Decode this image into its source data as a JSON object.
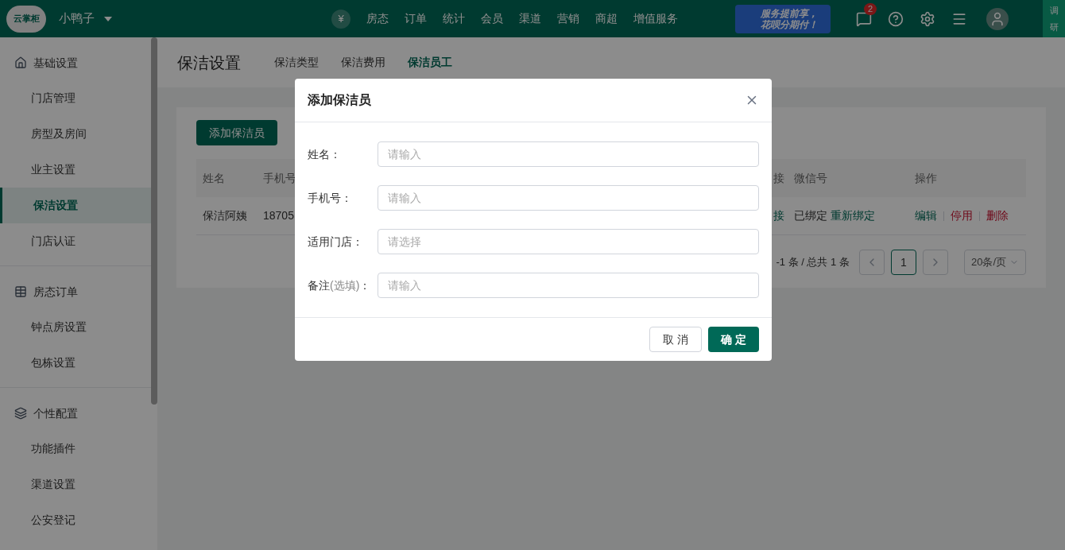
{
  "header": {
    "logo": "云掌柜",
    "store": "小鸭子",
    "currency_icon": "¥",
    "nav": [
      {
        "label": "房态"
      },
      {
        "label": "订单"
      },
      {
        "label": "统计"
      },
      {
        "label": "会员"
      },
      {
        "label": "渠道"
      },
      {
        "label": "营销"
      },
      {
        "label": "商超"
      },
      {
        "label": "增值服务"
      }
    ],
    "banner": {
      "line1": "服务提前享，",
      "line2": "花呗分期付！"
    },
    "message_count": "2",
    "survey": "调研"
  },
  "sidebar": [
    {
      "title": "基础设置",
      "items": [
        {
          "label": "门店管理",
          "selected": false
        },
        {
          "label": "房型及房间",
          "selected": false
        },
        {
          "label": "业主设置",
          "selected": false
        },
        {
          "label": "保洁设置",
          "selected": true
        },
        {
          "label": "门店认证",
          "selected": false
        }
      ]
    },
    {
      "title": "房态订单",
      "items": [
        {
          "label": "钟点房设置",
          "selected": false
        },
        {
          "label": "包栋设置",
          "selected": false
        }
      ]
    },
    {
      "title": "个性配置",
      "items": [
        {
          "label": "功能插件",
          "selected": false
        },
        {
          "label": "渠道设置",
          "selected": false
        },
        {
          "label": "公安登记",
          "selected": false
        }
      ]
    }
  ],
  "page": {
    "title": "保洁设置",
    "tabs": [
      {
        "label": "保洁类型",
        "selected": false
      },
      {
        "label": "保洁费用",
        "selected": false
      },
      {
        "label": "保洁员工",
        "selected": true
      }
    ],
    "add_button": "添加保洁员",
    "table": {
      "columns": [
        "姓名",
        "手机号",
        "接",
        "微信号",
        "操作"
      ],
      "rows": [
        {
          "name": "保洁阿姨",
          "phone": "18705",
          "column_3": "接",
          "wechat": "已绑定",
          "rebind": "重新绑定",
          "actions": [
            {
              "label": "编辑",
              "kind": "normal"
            },
            {
              "label": "停用",
              "kind": "danger"
            },
            {
              "label": "删除",
              "kind": "danger"
            }
          ]
        }
      ]
    },
    "pagination": {
      "summary": "-1 条 / 总共 1 条",
      "pages": [
        {
          "label": "1",
          "selected": true
        }
      ],
      "page_size": "20条/页"
    }
  },
  "dialog": {
    "title": "添加保洁员",
    "fields": [
      {
        "label": "姓名：",
        "placeholder": "请输入"
      },
      {
        "label": "手机号：",
        "placeholder": "请输入"
      },
      {
        "label": "适用门店：",
        "placeholder": "请选择"
      },
      {
        "label": "备注",
        "hint": "(选填)",
        "suffix": "：",
        "placeholder": "请输入"
      }
    ],
    "buttons": [
      {
        "label": "取 消",
        "kind": "default"
      },
      {
        "label": "确 定",
        "kind": "primary"
      }
    ]
  }
}
